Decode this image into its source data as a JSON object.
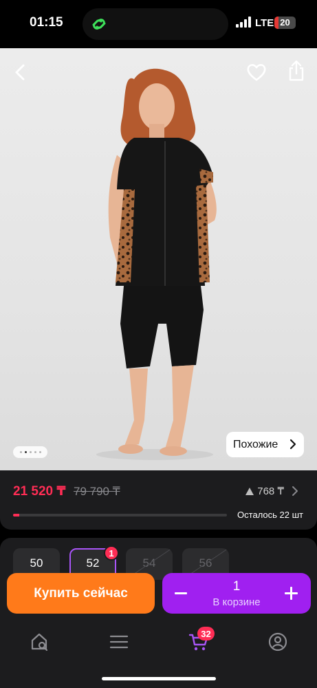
{
  "status_bar": {
    "time": "01:15",
    "network": "LTE",
    "battery": "20",
    "battery_level": 0.2
  },
  "product_image": {
    "icons": [
      "back-arrow-icon",
      "heart-icon",
      "share-icon"
    ],
    "gallery_dots": 5,
    "gallery_active_index": 1,
    "similar_label": "Похожие"
  },
  "price": {
    "current": "21 520 ₸",
    "old": "79 790 ₸",
    "rating_count": "768 ₸",
    "stock_label": "Осталось 22 шт",
    "stock_progress": 0.03
  },
  "sizes": {
    "items": [
      {
        "label": "50",
        "state": "available"
      },
      {
        "label": "52",
        "state": "selected",
        "badge": "1"
      },
      {
        "label": "54",
        "state": "unavailable"
      },
      {
        "label": "56",
        "state": "unavailable"
      }
    ]
  },
  "actions": {
    "buy_now": "Купить сейчас",
    "cart_quantity": "1",
    "cart_label": "В корзине"
  },
  "tabbar": {
    "items": [
      {
        "name": "home-search",
        "icon": "home-search-icon"
      },
      {
        "name": "catalog",
        "icon": "menu-icon"
      },
      {
        "name": "cart",
        "icon": "cart-icon",
        "badge": "32"
      },
      {
        "name": "profile",
        "icon": "profile-icon"
      }
    ]
  },
  "colors": {
    "accent_red": "#ff2d55",
    "buy_orange": "#ff7a1a",
    "cart_purple": "#a020f0",
    "card_bg": "#1c1c1e"
  }
}
